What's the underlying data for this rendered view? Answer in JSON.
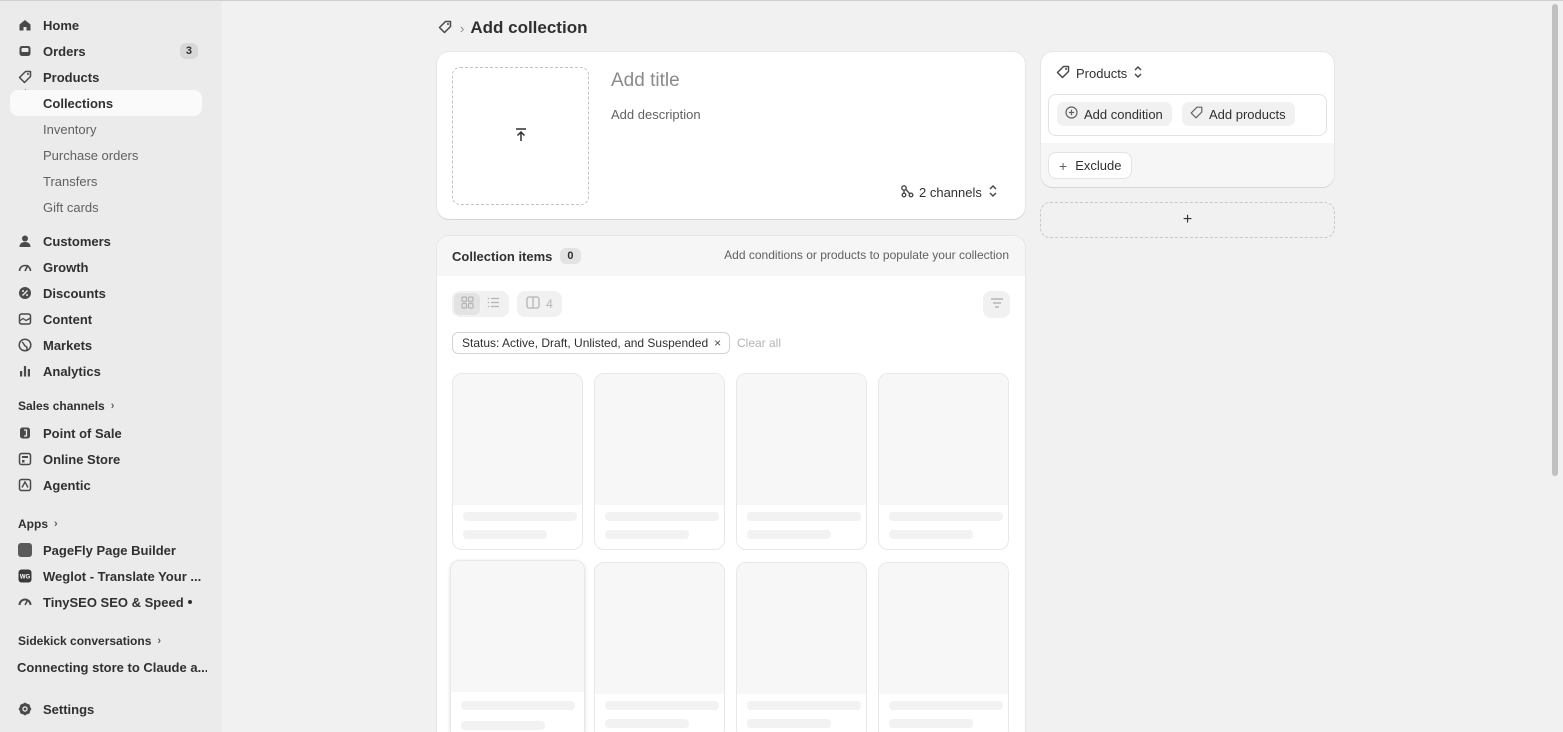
{
  "sidebar": {
    "home": "Home",
    "orders": "Orders",
    "orders_badge": "3",
    "products": "Products",
    "collections": "Collections",
    "inventory": "Inventory",
    "purchase_orders": "Purchase orders",
    "transfers": "Transfers",
    "gift_cards": "Gift cards",
    "customers": "Customers",
    "growth": "Growth",
    "discounts": "Discounts",
    "content": "Content",
    "markets": "Markets",
    "analytics": "Analytics",
    "sales_channels": "Sales channels",
    "point_of_sale": "Point of Sale",
    "online_store": "Online Store",
    "agentic": "Agentic",
    "apps": "Apps",
    "app_pagefly": "PageFly Page Builder",
    "app_weglot": "Weglot - Translate Your ...",
    "app_tinyseo": "TinySEO SEO & Speed",
    "sidekick": "Sidekick conversations",
    "conversation": "Connecting store to Claude a...",
    "settings": "Settings"
  },
  "page": {
    "title": "Add collection",
    "add_title_placeholder": "Add title",
    "add_description_placeholder": "Add description",
    "channels": "2 channels",
    "items_title": "Collection items",
    "items_count": "0",
    "items_hint": "Add conditions or products to populate your collection",
    "columns_count": "4",
    "filter_chip": "Status: Active, Draft, Unlisted, and Suspended",
    "clear_all": "Clear all"
  },
  "rules": {
    "selector": "Products",
    "add_condition": "Add condition",
    "add_products": "Add products",
    "exclude": "Exclude",
    "add_rule": "+"
  }
}
